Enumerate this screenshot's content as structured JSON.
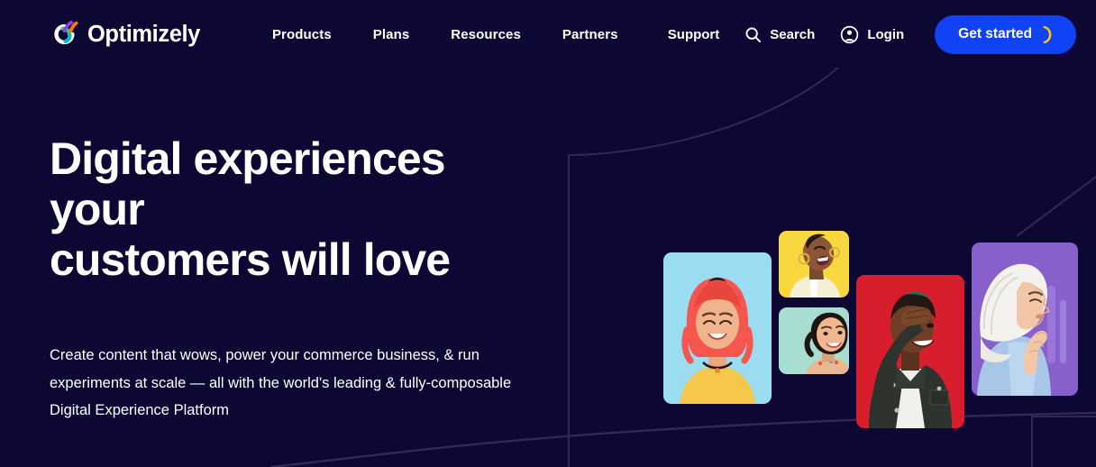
{
  "theme": {
    "background": "#0C0733",
    "text": "#FFFFFF",
    "cta_background": "#1043F5",
    "cta_glyph": "#FFC800",
    "decor_line": "#2E2A55"
  },
  "header": {
    "brand": {
      "name": "Optimizely",
      "logo_icon": "optimizely-logo-icon",
      "logo_colors": [
        "#8B3FE8",
        "#FF7A00",
        "#2ECC71",
        "#00BCD4",
        "#FFFFFF"
      ]
    },
    "nav": [
      {
        "label": "Products"
      },
      {
        "label": "Plans"
      },
      {
        "label": "Resources"
      },
      {
        "label": "Partners"
      }
    ],
    "utilities": [
      {
        "label": "Support",
        "icon": null
      },
      {
        "label": "Search",
        "icon": "search-icon"
      },
      {
        "label": "Login",
        "icon": "user-circle-icon"
      }
    ],
    "cta": {
      "label": "Get started",
      "icon": "crescent-arc-icon"
    }
  },
  "hero": {
    "title_line1": "Digital experiences your",
    "title_line2": "customers will love",
    "subtitle": "Create content that wows, power your commerce business, & run experiments at scale — all with the world's leading & fully-composable Digital Experience Platform"
  },
  "collage": {
    "cards": [
      {
        "name": "photo-card-smiling-woman-pink-hair",
        "background": "#9BDCF0",
        "alt": "Smiling woman with pink hair on light blue background"
      },
      {
        "name": "photo-card-laughing-woman",
        "background": "#F9D83F",
        "alt": "Laughing woman in cream jacket on yellow background"
      },
      {
        "name": "photo-card-smiling-woman-mint",
        "background": "#A8DED2",
        "alt": "Smiling woman with dark curly hair on mint background"
      },
      {
        "name": "photo-card-smiling-man-red",
        "background": "#D81E2C",
        "alt": "Smiling man with hand on forehead on red background"
      },
      {
        "name": "photo-card-woman-hijab",
        "background": "#8860CC",
        "alt": "Woman in white hijab on purple background"
      }
    ]
  }
}
